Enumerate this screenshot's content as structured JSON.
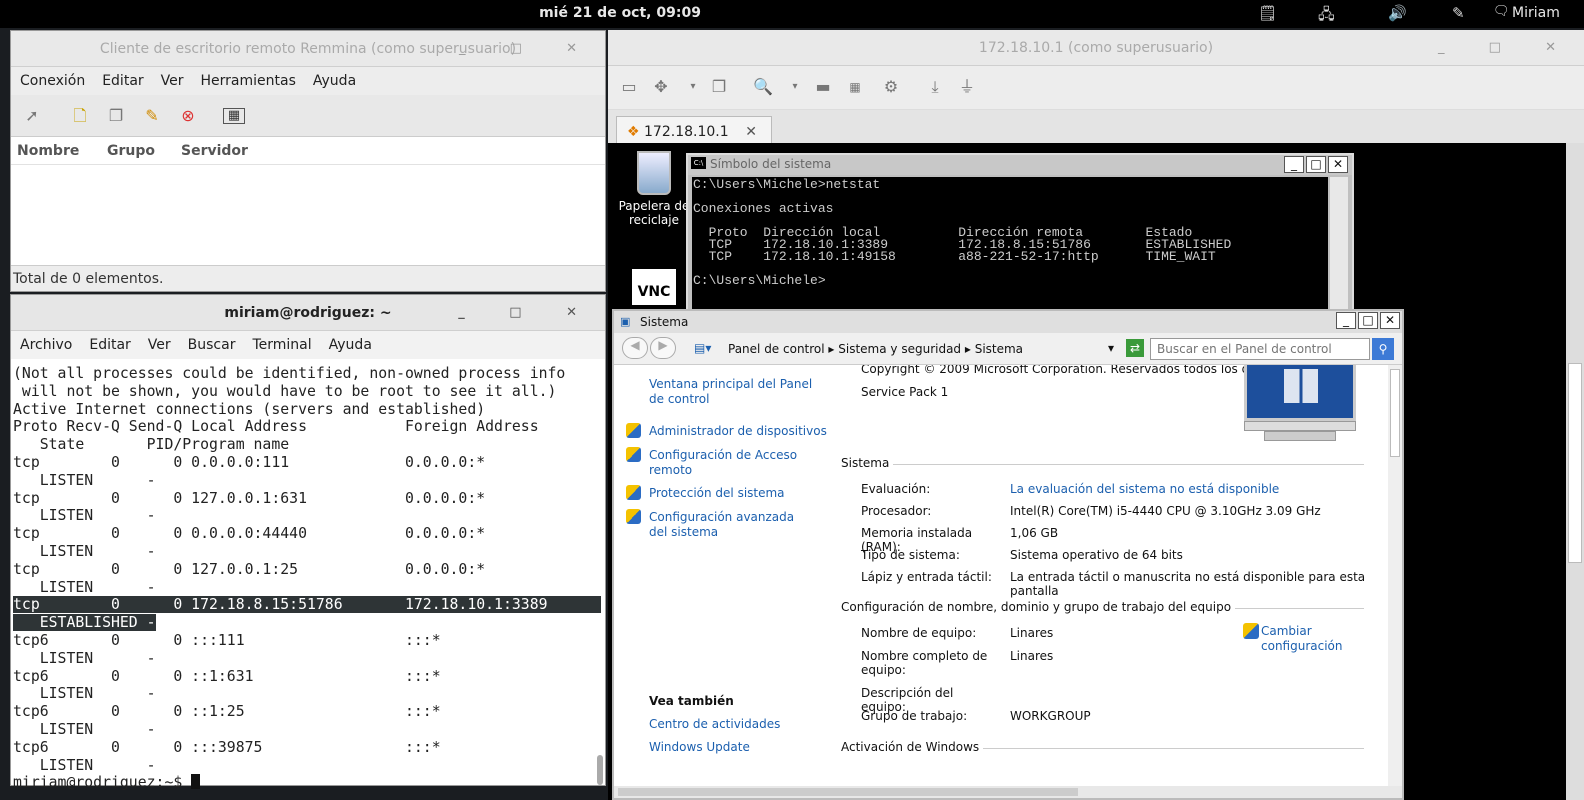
{
  "topbar": {
    "clock": "mié 21 de oct, 09:09",
    "user": "Miriam",
    "tray_icons": [
      "notification-icon",
      "network-icon",
      "volume-icon",
      "accessibility-icon",
      "chat-icon"
    ]
  },
  "remmina": {
    "title": "Cliente de escritorio remoto Remmina (como superusuario)",
    "menu": [
      "Conexión",
      "Editar",
      "Ver",
      "Herramientas",
      "Ayuda"
    ],
    "columns": [
      "Nombre",
      "Grupo",
      "Servidor"
    ],
    "status": "Total de 0 elementos."
  },
  "terminal": {
    "title": "miriam@rodriguez: ~",
    "menu": [
      "Archivo",
      "Editar",
      "Ver",
      "Buscar",
      "Terminal",
      "Ayuda"
    ],
    "lines_before": [
      "(Not all processes could be identified, non-owned process info",
      " will not be shown, you would have to be root to see it all.)",
      "Active Internet connections (servers and established)",
      "Proto Recv-Q Send-Q Local Address           Foreign Address",
      "   State       PID/Program name",
      "tcp        0      0 0.0.0.0:111             0.0.0.0:*",
      "   LISTEN      -",
      "tcp        0      0 127.0.0.1:631           0.0.0.0:*",
      "   LISTEN      -",
      "tcp        0      0 0.0.0.0:44440           0.0.0.0:*",
      "   LISTEN      -",
      "tcp        0      0 127.0.0.1:25            0.0.0.0:*",
      "   LISTEN      -"
    ],
    "highlight_line1": "tcp        0      0 172.18.8.15:51786       172.18.10.1:3389      ",
    "highlight_line2": "   ESTABLISHED -",
    "lines_after": [
      "tcp6       0      0 :::111                  :::*",
      "   LISTEN      -",
      "tcp6       0      0 ::1:631                 :::*",
      "   LISTEN      -",
      "tcp6       0      0 ::1:25                  :::*",
      "   LISTEN      -",
      "tcp6       0      0 :::39875                :::*",
      "   LISTEN      -"
    ],
    "prompt": "miriam@rodriguez:~$ "
  },
  "rdp": {
    "title": "172.18.10.1 (como superusuario)",
    "tab_label": "172.18.10.1",
    "desktop": {
      "recycle_bin_label": "Papelera de reciclaje",
      "vnc_label": "VNC"
    },
    "cmd": {
      "title": "Símbolo del sistema",
      "lines": [
        "C:\\Users\\Michele>netstat",
        "",
        "Conexiones activas",
        "",
        "  Proto  Dirección local          Dirección remota        Estado",
        "  TCP    172.18.10.1:3389         172.18.8.15:51786       ESTABLISHED",
        "  TCP    172.18.10.1:49158        a88-221-52-17:http      TIME_WAIT",
        "",
        "C:\\Users\\Michele>"
      ]
    },
    "system": {
      "title": "Sistema",
      "breadcrumb": [
        "Panel de control",
        "Sistema y seguridad",
        "Sistema"
      ],
      "search_placeholder": "Buscar en el Panel de control",
      "left_links": [
        "Ventana principal del Panel de control",
        "Administrador de dispositivos",
        "Configuración de Acceso remoto",
        "Protección del sistema",
        "Configuración avanzada del sistema"
      ],
      "see_also_title": "Vea también",
      "see_also": [
        "Centro de actividades",
        "Windows Update"
      ],
      "copyright": "Copyright © 2009 Microsoft Corporation. Reservados todos los derechos.",
      "service_pack": "Service Pack 1",
      "section_system": "Sistema",
      "rows": [
        {
          "label": "Evaluación:",
          "value": "La evaluación del sistema no está disponible"
        },
        {
          "label": "Procesador:",
          "value": "Intel(R) Core(TM) i5-4440 CPU @ 3.10GHz   3.09 GHz"
        },
        {
          "label": "Memoria instalada (RAM):",
          "value": "1,06 GB"
        },
        {
          "label": "Tipo de sistema:",
          "value": "Sistema operativo de 64 bits"
        },
        {
          "label": "Lápiz y entrada táctil:",
          "value": "La entrada táctil o manuscrita no está disponible para esta pantalla"
        }
      ],
      "section_name": "Configuración de nombre, dominio y grupo de trabajo del equipo",
      "name_rows": [
        {
          "label": "Nombre de equipo:",
          "value": "Linares"
        },
        {
          "label": "Nombre completo de equipo:",
          "value": "Linares"
        },
        {
          "label": "Descripción del equipo:",
          "value": ""
        },
        {
          "label": "Grupo de trabajo:",
          "value": "WORKGROUP"
        }
      ],
      "change_settings": "Cambiar configuración",
      "section_activation": "Activación de Windows"
    }
  }
}
